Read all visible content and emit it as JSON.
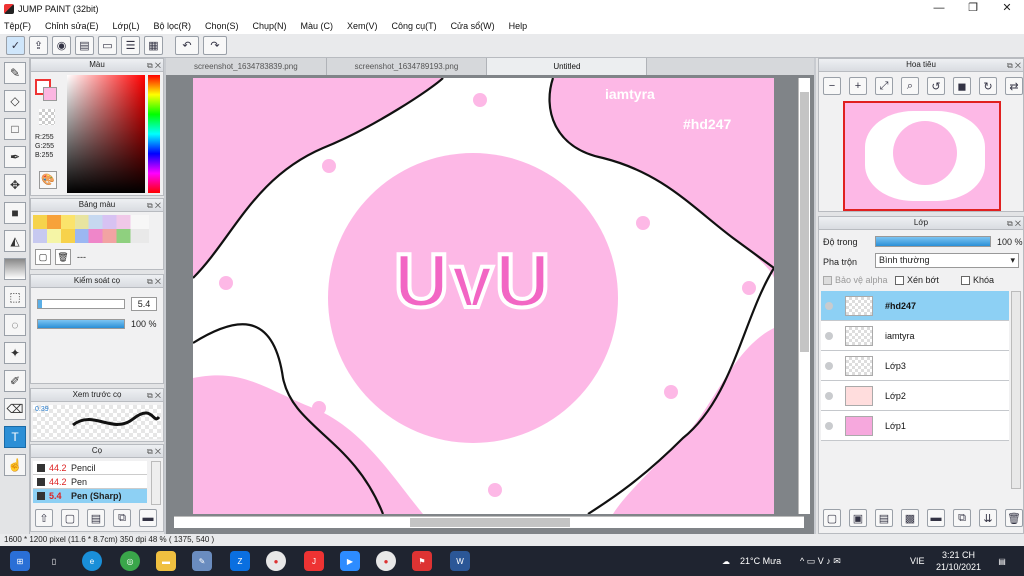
{
  "window": {
    "title": "JUMP PAINT (32bit)",
    "minimize": "—",
    "maximize": "❐",
    "close": "✕"
  },
  "menu": [
    "Tệp(F)",
    "Chỉnh sửa(E)",
    "Lớp(L)",
    "Bộ lọc(R)",
    "Chọn(S)",
    "Chụp(N)",
    "Màu (C)",
    "Xem(V)",
    "Công cụ(T)",
    "Cửa sổ(W)",
    "Help"
  ],
  "panels": {
    "color": {
      "title": "Màu",
      "r": "R:255",
      "g": "G:255",
      "b": "B:255"
    },
    "palette": {
      "title": "Bảng màu",
      "more": "---"
    },
    "brush_control": {
      "title": "Kiểm soát cọ",
      "size": "5.4",
      "opacity": "100 %"
    },
    "brush_preview": {
      "title": "Xem trước cọ",
      "value": "0.39"
    },
    "brushes": {
      "title": "Cọ",
      "items": [
        {
          "size": "44.2",
          "name": "Pencil"
        },
        {
          "size": "44.2",
          "name": "Pen"
        },
        {
          "size": "5.4",
          "name": "Pen (Sharp)"
        }
      ]
    },
    "navigator": {
      "title": "Hoa tiêu"
    },
    "layers": {
      "title": "Lớp",
      "opacity_label": "Độ trong",
      "opacity_value": "100 %",
      "blend_label": "Pha trộn",
      "blend_value": "Bình thường",
      "protect_alpha": "Bảo vệ alpha",
      "clip": "Xén bớt",
      "lock": "Khóa",
      "items": [
        "#hd247",
        "iamtyra",
        "Lớp3",
        "Lớp2",
        "Lớp1"
      ]
    }
  },
  "tabs": [
    "screenshot_1634783839.png",
    "screenshot_1634789193.png",
    "Untitled"
  ],
  "artwork": {
    "text_main": "UvU",
    "text_tag": "#hd247",
    "text_name": "iamtyra"
  },
  "status": "1600 * 1200 pixel   (11.6 * 8.7cm)   350 dpi   48 %   ( 1375, 540 )",
  "taskbar": {
    "weather": "21°C  Mưa",
    "lang": "VIE",
    "time": "3:21 CH",
    "date": "21/10/2021"
  },
  "colors": {
    "accent": "#2c8fd6",
    "pink": "#fdb8e6",
    "selection": "#8dd0f4",
    "taskbar": "#1f2430"
  }
}
